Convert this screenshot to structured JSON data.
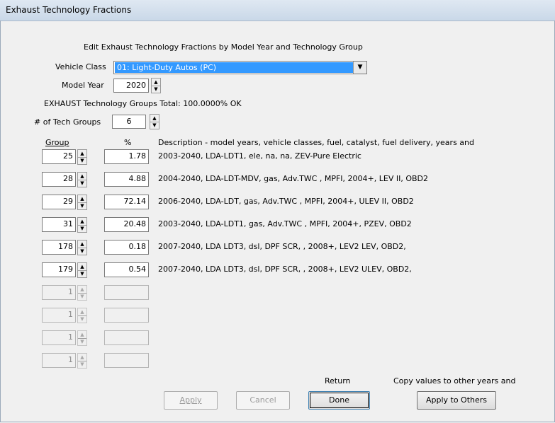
{
  "window": {
    "title": "Exhaust Technology Fractions"
  },
  "header": "Edit Exhaust Technology Fractions by Model Year and Technology Group",
  "vehicle_class": {
    "label": "Vehicle Class",
    "value": "01: Light-Duty Autos (PC)"
  },
  "model_year": {
    "label": "Model Year",
    "value": "2020"
  },
  "total_status": "EXHAUST Technology Groups Total: 100.0000%  OK",
  "tech_groups": {
    "label": "# of Tech Groups",
    "value": "6"
  },
  "columns": {
    "group": "Group",
    "pct": "%",
    "description": "Description - model years, vehicle classes, fuel, catalyst, fuel delivery, years and"
  },
  "rows": [
    {
      "group": "25",
      "pct": "1.78",
      "desc": "2003-2040, LDA-LDT1, ele, na, na, ZEV-Pure Electric"
    },
    {
      "group": "28",
      "pct": "4.88",
      "desc": "2004-2040, LDA-LDT-MDV, gas, Adv.TWC , MPFI, 2004+, LEV II, OBD2"
    },
    {
      "group": "29",
      "pct": "72.14",
      "desc": "2006-2040, LDA-LDT, gas, Adv.TWC , MPFI, 2004+, ULEV II, OBD2"
    },
    {
      "group": "31",
      "pct": "20.48",
      "desc": "2003-2040, LDA-LDT1, gas, Adv.TWC , MPFI, 2004+, PZEV, OBD2"
    },
    {
      "group": "178",
      "pct": "0.18",
      "desc": "2007-2040, LDA LDT3, dsl, DPF SCR,  , 2008+, LEV2 LEV, OBD2,"
    },
    {
      "group": "179",
      "pct": "0.54",
      "desc": "2007-2040, LDA LDT3, dsl, DPF SCR,  , 2008+, LEV2 ULEV, OBD2,"
    },
    {
      "group": "1",
      "pct": "",
      "desc": ""
    },
    {
      "group": "1",
      "pct": "",
      "desc": ""
    },
    {
      "group": "1",
      "pct": "",
      "desc": ""
    },
    {
      "group": "1",
      "pct": "",
      "desc": ""
    }
  ],
  "footer": {
    "return_label": "Return",
    "copy_label": "Copy values to other years and",
    "apply": "Apply",
    "cancel": "Cancel",
    "done": "Done",
    "apply_others": "Apply to Others"
  }
}
